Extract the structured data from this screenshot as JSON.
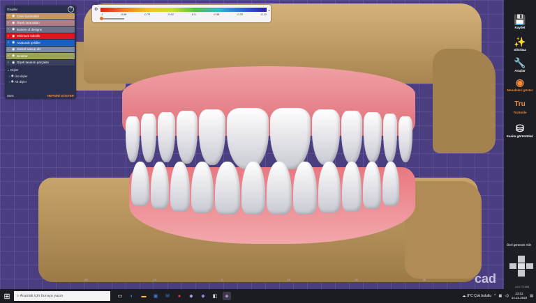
{
  "panel": {
    "title": "Gruplar",
    "help": "?",
    "groups": [
      {
        "label": "Cene taramalari",
        "color": "#c59a5a"
      },
      {
        "label": "Dişeti taramaları",
        "color": "#b07e84"
      },
      {
        "label": "Bottom of designs",
        "color": "#6e6f86"
      },
      {
        "label": "Minimum kalınlık",
        "color": "#e0141c"
      },
      {
        "label": "Anatomik şekiller",
        "color": "#1a5fc4"
      },
      {
        "label": "Swisel waxup afs",
        "color": "#7c8aa0"
      },
      {
        "label": "Bıraklar",
        "color": "#9ba25e"
      },
      {
        "label": "Dişeti tasarım parçaları",
        "color": "#3a3f5c"
      }
    ],
    "section_teeth": "Dişler",
    "teeth_items": [
      "Üst dişler",
      "Alt dişler"
    ],
    "section_bottom": "Sürü",
    "show_all": "HEPSİNİ GÖSTER"
  },
  "distance_bar": {
    "labels": [
      "-1",
      "-0.86",
      "-0.75",
      "-0.62",
      "-0.5",
      "-0.38",
      "-0.25",
      "-0.12"
    ],
    "slider_value": 0
  },
  "axis_labels": [
    "-20",
    "-10",
    "0",
    "10",
    "20",
    "30"
  ],
  "watermark": "cad",
  "sidebar": {
    "buttons": [
      {
        "label": "Kaydet",
        "icon": "💾",
        "active": false
      },
      {
        "label": "Sihirbaz",
        "icon": "✨",
        "active": false
      },
      {
        "label": "Araçlar",
        "icon": "🔧",
        "active": false
      },
      {
        "label": "Mesafeleri göster",
        "icon": "◉",
        "active": true
      },
      {
        "label": "TruSmile",
        "icon": "Tru",
        "active": true
      },
      {
        "label": "Kesim görüntüleri",
        "icon": "⛁",
        "active": false
      }
    ],
    "gizmo_label": "Özel görünüm ekle",
    "version": "v3.0-7714/64"
  },
  "taskbar": {
    "search_placeholder": "Aramak için buraya yazın",
    "weather": "8°C  Çok bulutlu",
    "time": "23:02",
    "date": "14.12.2022"
  }
}
